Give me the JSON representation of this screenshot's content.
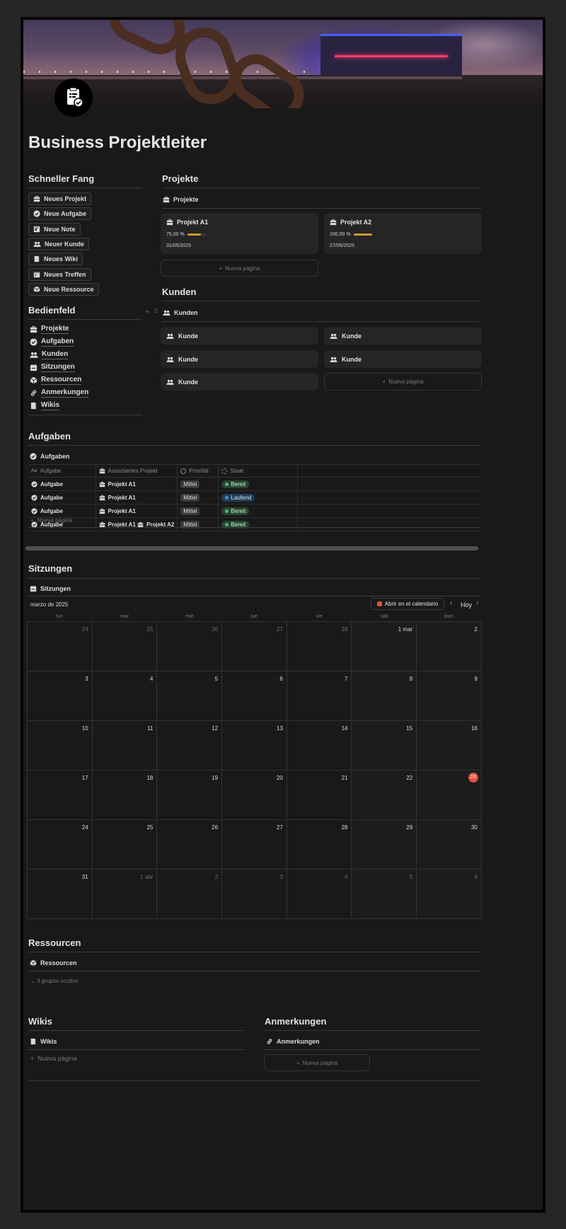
{
  "page": {
    "title": "Business Projektleiter"
  },
  "quick": {
    "heading": "Schneller Fang",
    "buttons": [
      "Neues Projekt",
      "Neue Aufgabe",
      "Neue Note",
      "Neuer Kunde",
      "Neues Wiki",
      "Neues Treffen",
      "Neue Ressource"
    ]
  },
  "panel": {
    "heading": "Bedienfeld",
    "links": [
      "Projekte",
      "Aufgaben",
      "Kunden",
      "Sitzungen",
      "Ressourcen",
      "Anmerkungen",
      "Wikis"
    ]
  },
  "projects": {
    "heading": "Projekte",
    "view": "Projekte",
    "cards": [
      {
        "name": "Projekt A1",
        "progress_label": "75,00 %",
        "progress": 0.75,
        "date": "31/05/2025"
      },
      {
        "name": "Projekt A2",
        "progress_label": "100,00 %",
        "progress": 1.0,
        "date": "27/05/2025"
      }
    ],
    "new_page": "Nueva página"
  },
  "clients": {
    "heading": "Kunden",
    "view": "Kunden",
    "cards": [
      "Kunde",
      "Kunde",
      "Kunde",
      "Kunde",
      "Kunde"
    ],
    "new_page": "Nueva página"
  },
  "tasks": {
    "heading": "Aufgaben",
    "view": "Aufgaben",
    "columns": [
      "Aufgabe",
      "Assoziiertes Projekt",
      "Priorität",
      "Staat"
    ],
    "rows": [
      {
        "task": "Aufgabe",
        "projects": [
          "Projekt A1"
        ],
        "priority": "Mittel",
        "status": "Bereit"
      },
      {
        "task": "Aufgabe",
        "projects": [
          "Projekt A1"
        ],
        "priority": "Mittel",
        "status": "Laufend"
      },
      {
        "task": "Aufgabe",
        "projects": [
          "Projekt A1"
        ],
        "priority": "Mittel",
        "status": "Bereit"
      },
      {
        "task": "Aufgabe",
        "projects": [
          "Projekt A1",
          "Projekt A2"
        ],
        "priority": "Mittel",
        "status": "Bereit"
      }
    ],
    "new_page": "Nueva página"
  },
  "meetings": {
    "heading": "Sitzungen",
    "view": "Sitzungen",
    "month": "marzo de 2025",
    "open_calendar": "Abrir en el calendario",
    "today": "Hoy",
    "weekdays": [
      "lun",
      "mar",
      "mié",
      "jue",
      "vie",
      "sáb",
      "dom"
    ],
    "weeks": [
      [
        "24",
        "25",
        "26",
        "27",
        "28",
        "1 mar",
        "2"
      ],
      [
        "3",
        "4",
        "5",
        "6",
        "7",
        "8",
        "9"
      ],
      [
        "10",
        "11",
        "12",
        "13",
        "14",
        "15",
        "16"
      ],
      [
        "17",
        "18",
        "19",
        "20",
        "21",
        "22",
        "23"
      ],
      [
        "24",
        "25",
        "26",
        "27",
        "28",
        "29",
        "30"
      ],
      [
        "31",
        "1 abr",
        "2",
        "3",
        "4",
        "5",
        "6"
      ]
    ],
    "today_date": "23"
  },
  "resources": {
    "heading": "Ressourcen",
    "view": "Ressourcen",
    "hidden_groups": "3 grupos ocultos"
  },
  "wikis": {
    "heading": "Wikis",
    "view": "Wikis",
    "new_page": "Nueva página"
  },
  "notes": {
    "heading": "Anmerkungen",
    "view": "Anmerkungen",
    "new_page": "Nueva página"
  },
  "colors": {
    "accent_progress": "#c99a2e",
    "status_ready": "#23472f",
    "status_running": "#1f3d57",
    "today_marker": "#e0503d"
  }
}
